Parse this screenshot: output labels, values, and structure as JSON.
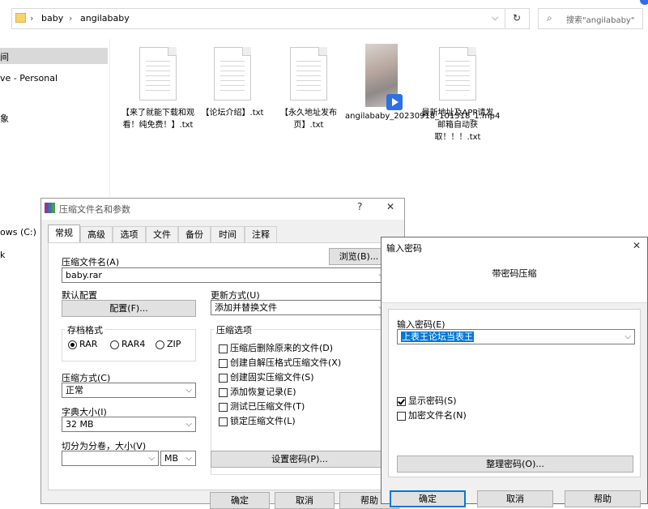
{
  "explorer": {
    "breadcrumb": [
      "baby",
      "angilababy"
    ],
    "search_placeholder": "搜索\"angilababy\"",
    "nav": [
      "间",
      "ve - Personal",
      "象",
      "ows (C:)",
      "k"
    ],
    "files": [
      {
        "name": "【来了就能下载和观看！纯免费！】.txt",
        "type": "txt"
      },
      {
        "name": "【论坛介绍】.txt",
        "type": "txt"
      },
      {
        "name": "【永久地址发布页】.txt",
        "type": "txt"
      },
      {
        "name": "angilababy_20230918_101518_1.mp4",
        "type": "video"
      },
      {
        "name": "最新地址及APP请发邮箱自动获取！！！.txt",
        "type": "txt"
      }
    ]
  },
  "archive_dialog": {
    "title": "压缩文件名和参数",
    "help": "?",
    "close": "✕",
    "tabs": [
      "常规",
      "高级",
      "选项",
      "文件",
      "备份",
      "时间",
      "注释"
    ],
    "archive_name_label": "压缩文件名(A)",
    "archive_name_value": "baby.rar",
    "browse_label": "浏览(B)...",
    "default_profile_label": "默认配置",
    "profiles_button": "配置(F)...",
    "update_mode_label": "更新方式(U)",
    "update_mode_value": "添加并替换文件",
    "format_label": "存档格式",
    "formats": [
      {
        "label": "RAR",
        "checked": true
      },
      {
        "label": "RAR4",
        "checked": false
      },
      {
        "label": "ZIP",
        "checked": false
      }
    ],
    "options_label": "压缩选项",
    "options": [
      {
        "label": "压缩后删除原来的文件(D)",
        "checked": false
      },
      {
        "label": "创建自解压格式压缩文件(X)",
        "checked": false
      },
      {
        "label": "创建固实压缩文件(S)",
        "checked": false
      },
      {
        "label": "添加恢复记录(E)",
        "checked": false
      },
      {
        "label": "测试已压缩文件(T)",
        "checked": false
      },
      {
        "label": "锁定压缩文件(L)",
        "checked": false
      }
    ],
    "method_label": "压缩方式(C)",
    "method_value": "正常",
    "dict_label": "字典大小(I)",
    "dict_value": "32 MB",
    "split_label": "切分为分卷，大小(V)",
    "split_value": "",
    "split_unit": "MB",
    "set_password_button": "设置密码(P)...",
    "footer_buttons": [
      "确定",
      "取消",
      "帮助"
    ]
  },
  "password_dialog": {
    "title": "输入密码",
    "close": "✕",
    "heading": "带密码压缩",
    "password_label": "输入密码(E)",
    "password_value": "上表王论坛当表王",
    "show_password_label": "显示密码(S)",
    "show_password_checked": true,
    "encrypt_names_label": "加密文件名(N)",
    "encrypt_names_checked": false,
    "organize_button": "整理密码(O)...",
    "footer_buttons": [
      "确定",
      "取消",
      "帮助"
    ]
  },
  "colors": {
    "accent": "#0078d7",
    "selection": "#0078d7",
    "dialog_bg": "#f0f0f0",
    "nav_selected": "#d9d9d9"
  }
}
